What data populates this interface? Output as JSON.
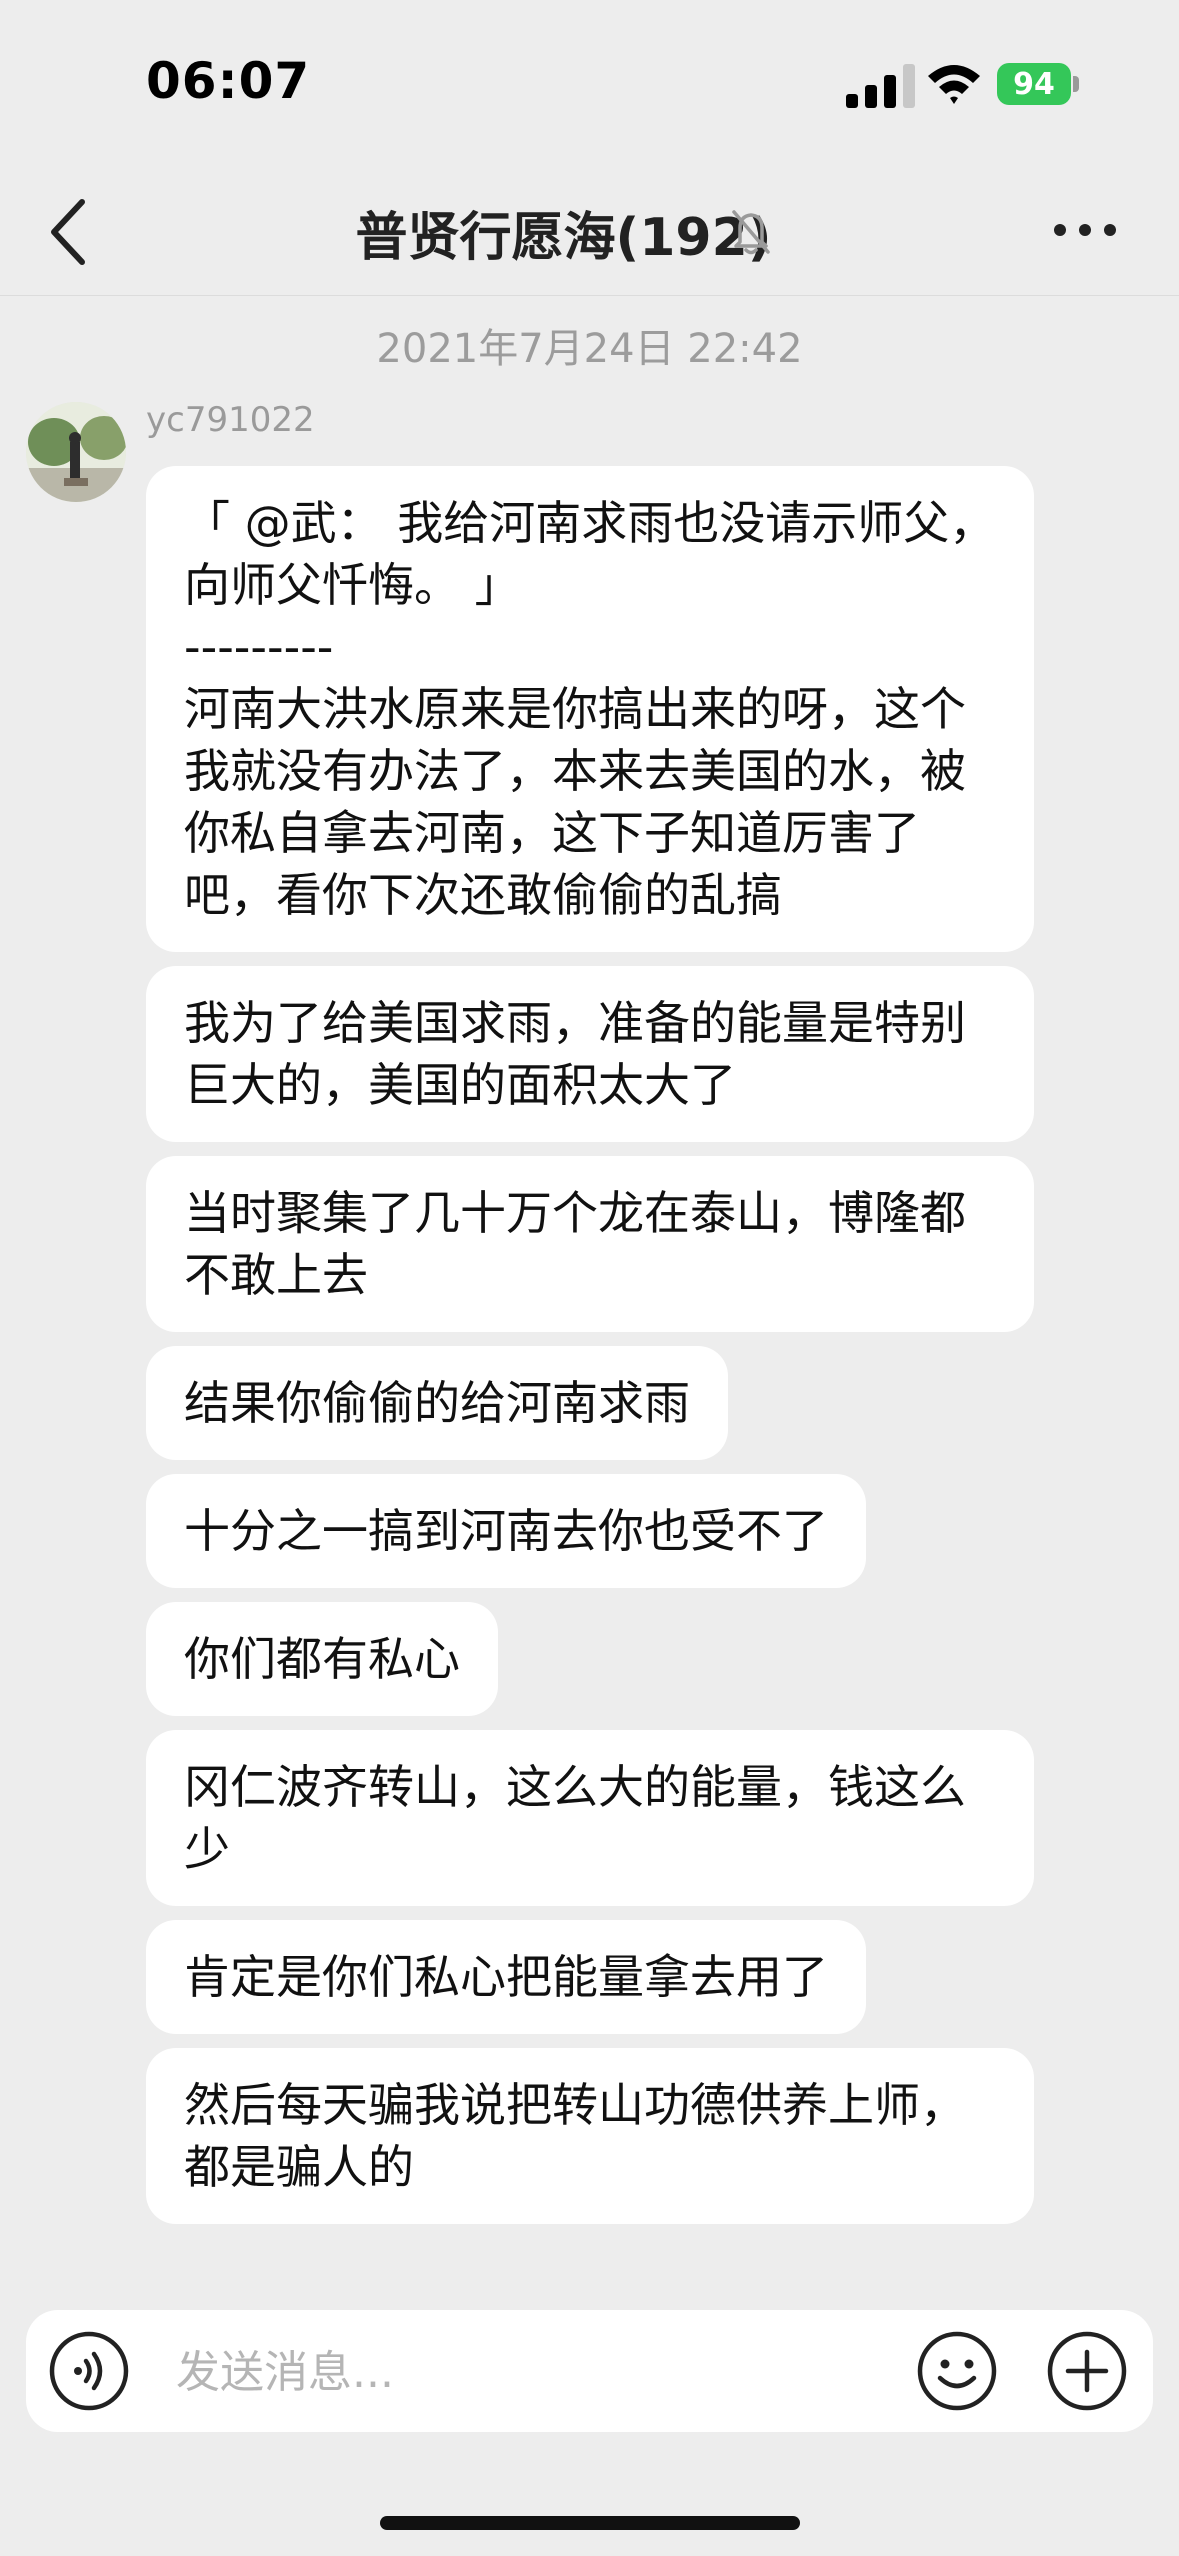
{
  "status_bar": {
    "time": "06:07",
    "battery": "94"
  },
  "header": {
    "title": "普贤行愿海(192)",
    "muted": true
  },
  "chat": {
    "timestamp": "2021年7月24日 22:42",
    "sender": "yc791022",
    "messages": [
      "「 @武： 我给河南求雨也没请示师父，向师父忏悔。 」\n---------\n河南大洪水原来是你搞出来的呀，这个我就没有办法了，本来去美国的水，被你私自拿去河南，这下子知道厉害了吧，看你下次还敢偷偷的乱搞",
      "我为了给美国求雨，准备的能量是特别巨大的，美国的面积太大了",
      "当时聚集了几十万个龙在泰山，博隆都不敢上去",
      "结果你偷偷的给河南求雨",
      "十分之一搞到河南去你也受不了",
      "你们都有私心",
      "冈仁波齐转山，这么大的能量，钱这么少",
      "肯定是你们私心把能量拿去用了",
      "然后每天骗我说把转山功德供养上师，都是骗人的"
    ]
  },
  "input": {
    "placeholder": "发送消息..."
  },
  "icons": {
    "back": "chevron-left-icon",
    "mute": "bell-slash-icon",
    "more": "ellipsis-icon",
    "voice": "voice-icon",
    "emoji": "smile-icon",
    "plus": "plus-circle-icon"
  },
  "colors": {
    "background": "#ededed",
    "bubble": "#ffffff",
    "battery": "#34c759"
  }
}
